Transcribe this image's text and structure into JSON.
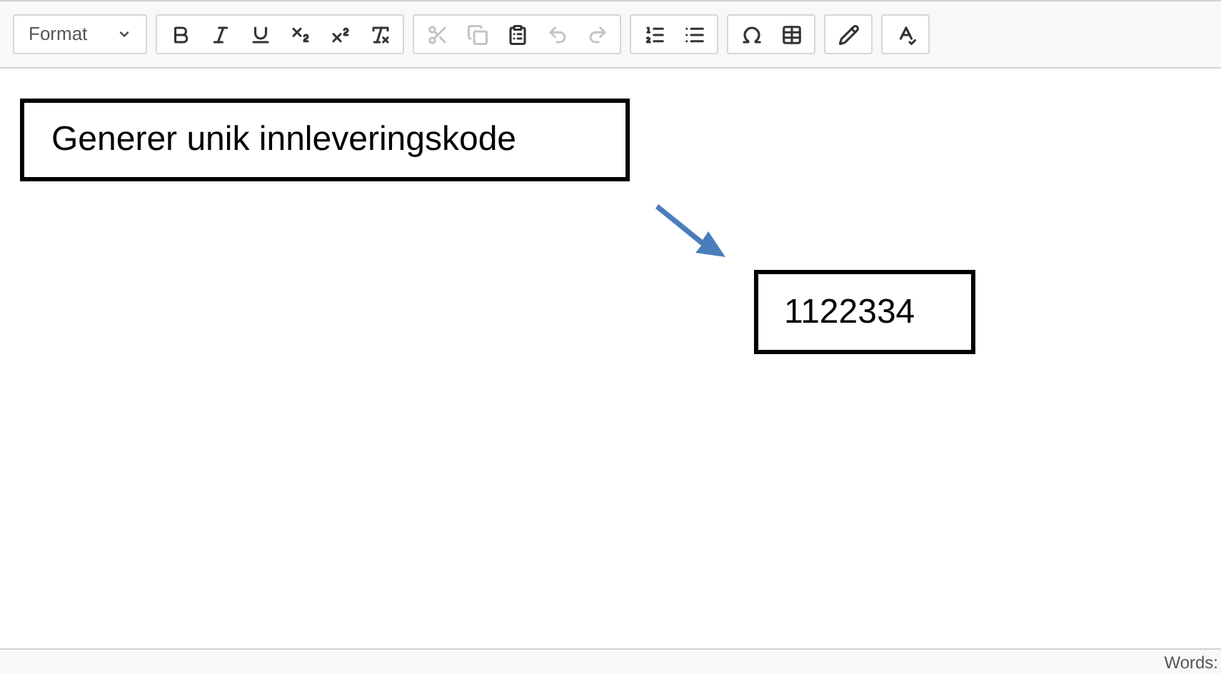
{
  "toolbar": {
    "format_dropdown": {
      "label": "Format"
    },
    "groups": [
      [
        {
          "kind": "bold",
          "disabled": false
        },
        {
          "kind": "italic",
          "disabled": false
        },
        {
          "kind": "underline",
          "disabled": false
        },
        {
          "kind": "subscript",
          "disabled": false
        },
        {
          "kind": "superscript",
          "disabled": false
        },
        {
          "kind": "clear-format",
          "disabled": false
        }
      ],
      [
        {
          "kind": "cut",
          "disabled": true
        },
        {
          "kind": "copy",
          "disabled": true
        },
        {
          "kind": "paste",
          "disabled": false
        },
        {
          "kind": "undo",
          "disabled": true
        },
        {
          "kind": "redo",
          "disabled": true
        }
      ],
      [
        {
          "kind": "numbered-list",
          "disabled": false
        },
        {
          "kind": "bulleted-list",
          "disabled": false
        }
      ],
      [
        {
          "kind": "special-character",
          "disabled": false
        },
        {
          "kind": "table",
          "disabled": false
        }
      ],
      [
        {
          "kind": "pencil",
          "disabled": false
        }
      ],
      [
        {
          "kind": "spellcheck",
          "disabled": false
        }
      ]
    ]
  },
  "content": {
    "button_box": {
      "text": "Generer unik innleveringskode"
    },
    "code_box": {
      "text": "1122334"
    }
  },
  "status_bar": {
    "word_count": "Words:"
  }
}
